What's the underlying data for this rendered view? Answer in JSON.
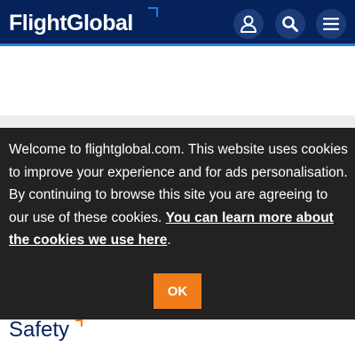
{
  "header": {
    "logo_text": "FlightGlobal",
    "account_icon": "user-icon",
    "search_icon": "search-icon",
    "menu_icon": "hamburger-menu-icon",
    "background_color": "#06225a",
    "accent_color": "#1e7fd6"
  },
  "cookie_banner": {
    "text": "Welcome to flightglobal.com. This website uses cookies to improve your experience and for ads personalisation. By continuing to browse this site you are agreeing to our use of these cookies. ",
    "link_text": "You can learn more about the cookies we use here",
    "trailing": ".",
    "ok_label": "OK",
    "background_color": "#222222",
    "button_color": "#f07d1a"
  },
  "section": {
    "title": "Safety"
  }
}
